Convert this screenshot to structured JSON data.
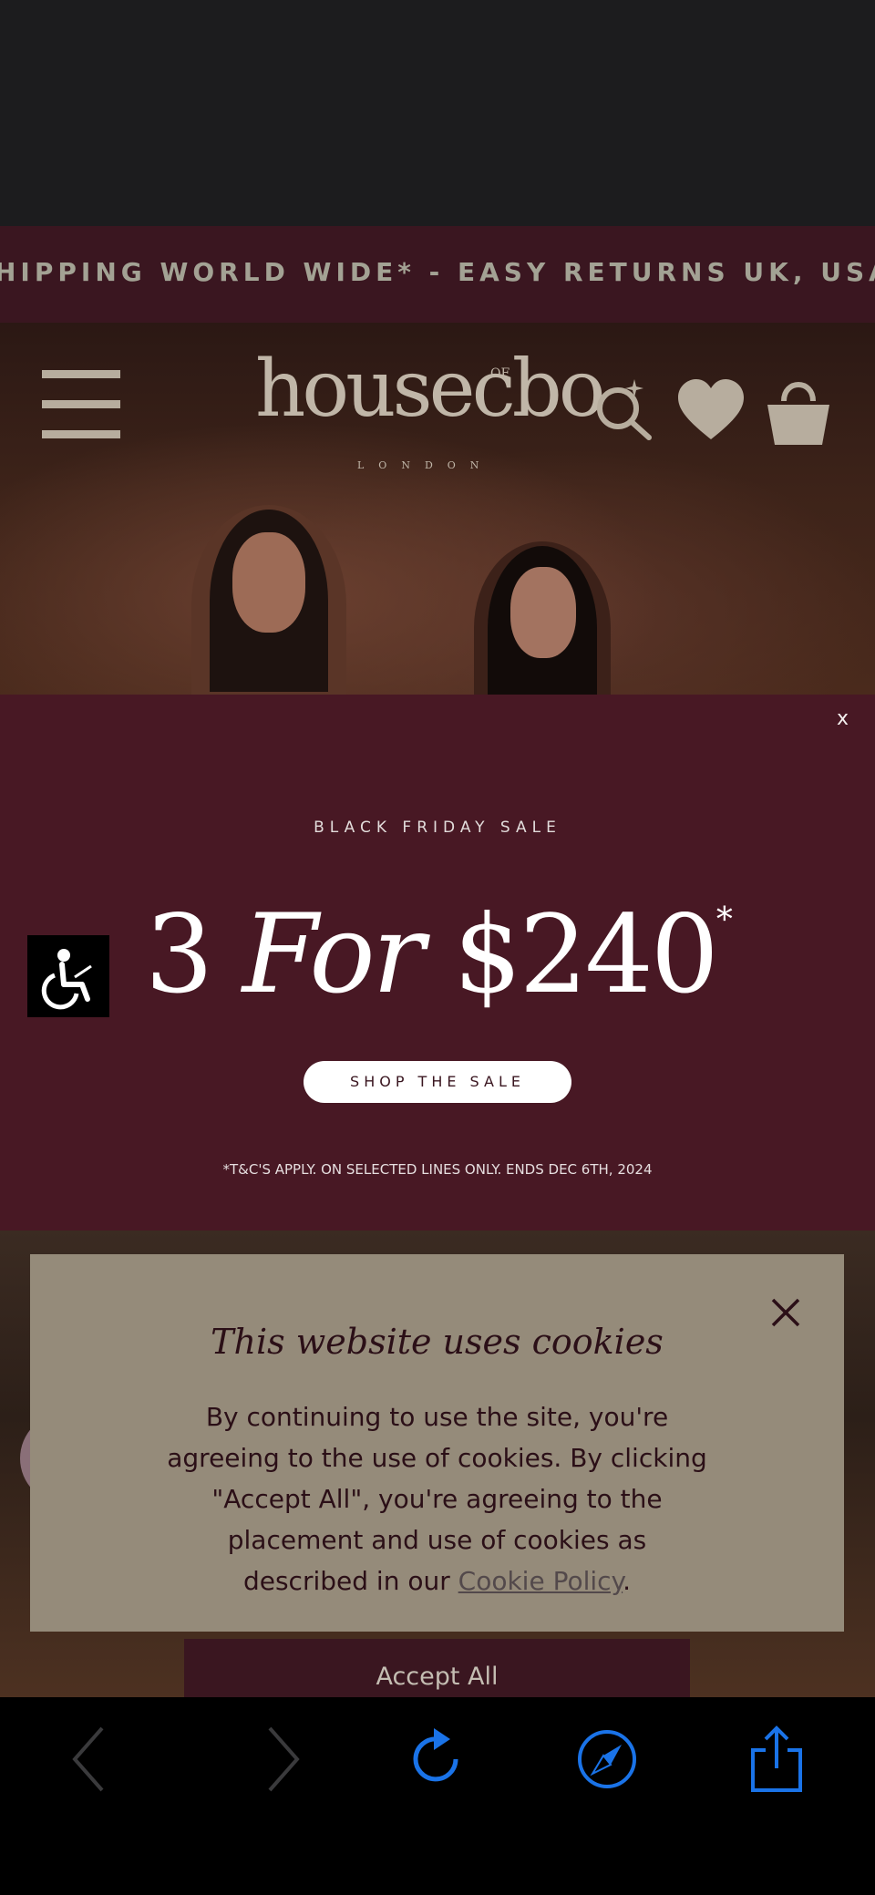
{
  "ticker": {
    "text": "HIPPING WORLD WIDE* - EASY RETURNS UK, USA AND"
  },
  "header": {
    "logo_main": "housecbo",
    "logo_of": "OF",
    "logo_sub": "LONDON"
  },
  "promo": {
    "close_label": "x",
    "eyebrow": "BLACK FRIDAY SALE",
    "headline_num": "3",
    "headline_mid": "For",
    "headline_price": "$240",
    "headline_mark": "*",
    "button_label": "SHOP THE SALE",
    "terms": "*T&C'S APPLY. ON SELECTED LINES ONLY. ENDS DEC 6TH, 2024"
  },
  "cookie": {
    "title": "This website uses cookies",
    "body": "By continuing to use the site, you're agreeing to the use of cookies. By clicking \"Accept All\", you're agreeing to the placement and use of cookies as described in our ",
    "link": "Cookie Policy",
    "period": ".",
    "accept_label": "Accept All"
  },
  "colors": {
    "ticker_bg": "#3a1620",
    "promo_bg": "#481824",
    "cookie_bg": "#958b7a",
    "toolbar_accent": "#1a73e8"
  },
  "toolbar": {
    "icons": [
      "back-icon",
      "forward-icon",
      "reload-icon",
      "compass-icon",
      "share-icon"
    ]
  }
}
